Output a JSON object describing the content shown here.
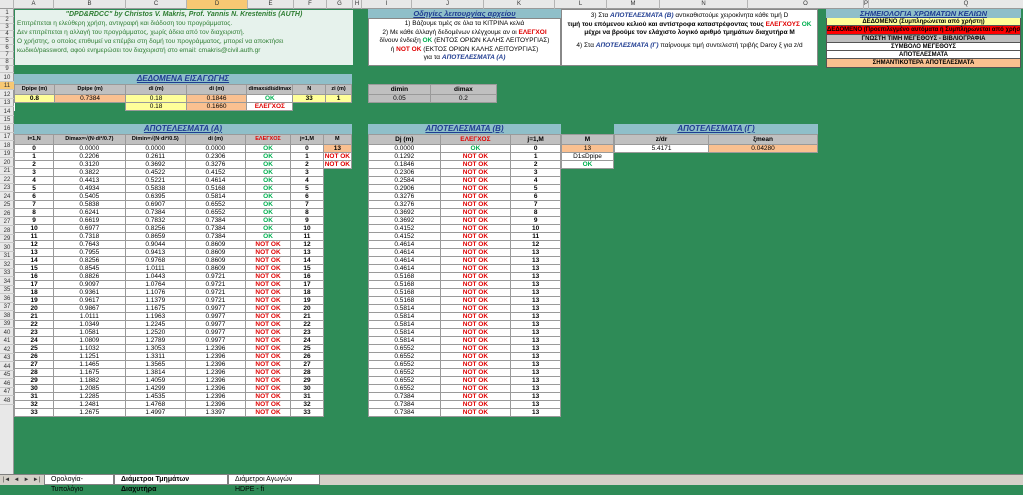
{
  "columns": [
    "A",
    "B",
    "C",
    "D",
    "E",
    "F",
    "G",
    "H",
    "I",
    "J",
    "K",
    "L",
    "M",
    "N",
    "O",
    "P",
    "Q"
  ],
  "header_box": {
    "title": "\"DPD&RDCC\" by Christos V. Makris, Prof. Yannis N. Krestenitis (AUTH)",
    "lines": [
      "Επιτρέπεται η ελεύθερη χρήση, αντιγραφή και διάδοση του προγράμματος.",
      "Δεν επιτρέπεται η αλλαγή του προγράμματος, χωρίς άδεια από τον διαχειριστή.",
      "Ο χρήστης, ο οποίος επιθυμεί να επέμβει στη δομή του προγράμματος, μπορεί να αποκτήσει",
      "κωδικό/password, αφού ενημερώσει τον διαχειριστή στο email: cmakris@civil.auth.gr"
    ]
  },
  "instructions": {
    "title": "Οδηγίες λειτουργίας αρχείου",
    "l1": "1) Βάζουμε τιμές σε όλα τα ΚΙΤΡΙΝΑ κελιά",
    "l2a": "2) Με κάθε άλλαγή δεδομένων ελέγχουμε αν οι",
    "l2b": "ΕΛΕΓΧΟΙ",
    "l2c": "δίνουν ένδειξη",
    "l2d": "OK",
    "l2e": "(ΕΝΤΟΣ ΟΡΙΩΝ ΚΑΛΗΣ ΛΕΙΤΟΥΡΓΙΑΣ)",
    "l2f": "ή",
    "l2g": "NOT OK",
    "l2h": "(ΕΚΤΟΣ ΟΡΙΩΝ ΚΑΛΗΣ ΛΕΙΤΟΥΡΓΙΑΣ)",
    "l2i": "για τα",
    "l2j": "ΑΠΟΤΕΛΕΣΜΑΤΑ (Α)",
    "l3a": "3) Στα",
    "l3b": "ΑΠΟΤΕΛΕΣΜΑΤΑ (Β)",
    "l3c": "αντικαθιστούμε χειροκίνητα κάθε τιμή D",
    "l3d": "τιμή του επόμενου κελιού και αντίστροφα καταστρέφοντας τους",
    "l3e": "ΕΛΕΓΧΟΥΣ",
    "l3f": "OK",
    "l3g": "μέχρι να βρούμε τον ελάχιστο λογικό αριθμό τμημάτων διαχυτήρα M",
    "l4a": "4) Στα",
    "l4b": "ΑΠΟΤΕΛΕΣΜΑΤΑ (Γ)",
    "l4c": "παίρνουμε τιμή συντελεστή τριβής Darcy ξ για z/d"
  },
  "legend": {
    "title": "ΣΗΜΕΙΟΛΟΓΙΑ ΧΡΩΜΑΤΩΝ ΚΕΛΙΩΝ",
    "items": [
      {
        "label": "ΔΕΔΟΜΕΝΟ (Συμπληρώνεται από χρήστη)",
        "color": "#ffff99",
        "text": "#000"
      },
      {
        "label": "ΔΕΔΟΜΕΝΟ (Προεπιλεγμένο αυτόματα ή Συμπληρώνεται από χρήστη)",
        "color": "#ff0000",
        "text": "#000"
      },
      {
        "label": "ΓΝΩΣΤΗ ΤΙΜΗ ΜΕΓΕΘΟΥΣ - ΒΙΒΛΙΟΓΡΑΦΙΑ",
        "color": "#bfbfbf",
        "text": "#000"
      },
      {
        "label": "ΣΥΜΒΟΛΟ ΜΕΓΕΘΟΥΣ",
        "color": "#ffffff",
        "text": "#000"
      },
      {
        "label": "ΑΠΟΤΕΛΕΣΜΑΤΑ",
        "color": "#ffffff",
        "text": "#000"
      },
      {
        "label": "ΣΗΜΑΝΤΙΚΟΤΕΡΑ ΑΠΟΤΕΛΕΣΜΑΤΑ",
        "color": "#fac090",
        "text": "#000"
      }
    ]
  },
  "input": {
    "title": "ΔΕΔΟΜΕΝΑ ΕΙΣΑΓΩΓΗΣ",
    "headers": [
      "Dpipe (m)",
      "Dpipe (m)",
      "di (m)",
      "di (m)",
      "dimax≤di≤dimax",
      "N",
      "zi (m)"
    ],
    "row10": [
      "0.8",
      "0.7384",
      "0.18",
      "0.1846",
      "OK",
      "33",
      "1"
    ],
    "row11": [
      "",
      "",
      "0.18",
      "0.1660",
      "ΕΛΕΓΧΟΣ",
      "",
      ""
    ],
    "right_headers": [
      "dimin",
      "dimax"
    ],
    "right_row": [
      "0.05",
      "0.2"
    ]
  },
  "resA": {
    "title": "ΑΠΟΤΕΛΕΣΜΑΤΑ (Α)",
    "headers": [
      "i=1,N",
      "Dimax=√(N·di²/0.7)",
      "Dimin=√(N·di²/0.5)",
      "di (m)",
      "ΕΛΕΓΧΟΣ",
      "j=1,M",
      "M"
    ],
    "M": "13",
    "m_extra": [
      "",
      "NOT OK",
      "NOT OK"
    ],
    "rows": [
      [
        "0",
        "0.0000",
        "0.0000",
        "0.0000",
        "OK",
        "0"
      ],
      [
        "1",
        "0.2206",
        "0.2611",
        "0.2306",
        "OK",
        "1"
      ],
      [
        "2",
        "0.3120",
        "0.3692",
        "0.3276",
        "OK",
        "2"
      ],
      [
        "3",
        "0.3822",
        "0.4522",
        "0.4152",
        "OK",
        "3"
      ],
      [
        "4",
        "0.4413",
        "0.5221",
        "0.4614",
        "OK",
        "4"
      ],
      [
        "5",
        "0.4934",
        "0.5838",
        "0.5168",
        "OK",
        "5"
      ],
      [
        "6",
        "0.5405",
        "0.6395",
        "0.5814",
        "OK",
        "6"
      ],
      [
        "7",
        "0.5838",
        "0.6907",
        "0.6552",
        "OK",
        "7"
      ],
      [
        "8",
        "0.6241",
        "0.7384",
        "0.6552",
        "OK",
        "8"
      ],
      [
        "9",
        "0.6619",
        "0.7832",
        "0.7384",
        "OK",
        "9"
      ],
      [
        "10",
        "0.6977",
        "0.8256",
        "0.7384",
        "OK",
        "10"
      ],
      [
        "11",
        "0.7318",
        "0.8659",
        "0.7384",
        "OK",
        "11"
      ],
      [
        "12",
        "0.7643",
        "0.9044",
        "0.8609",
        "NOT OK",
        "12"
      ],
      [
        "13",
        "0.7955",
        "0.9413",
        "0.8609",
        "NOT OK",
        "13"
      ],
      [
        "14",
        "0.8256",
        "0.9768",
        "0.8609",
        "NOT OK",
        "14"
      ],
      [
        "15",
        "0.8545",
        "1.0111",
        "0.8609",
        "NOT OK",
        "15"
      ],
      [
        "16",
        "0.8826",
        "1.0443",
        "0.9721",
        "NOT OK",
        "16"
      ],
      [
        "17",
        "0.9097",
        "1.0764",
        "0.9721",
        "NOT OK",
        "17"
      ],
      [
        "18",
        "0.9361",
        "1.1076",
        "0.9721",
        "NOT OK",
        "18"
      ],
      [
        "19",
        "0.9617",
        "1.1379",
        "0.9721",
        "NOT OK",
        "19"
      ],
      [
        "20",
        "0.9867",
        "1.1675",
        "0.9977",
        "NOT OK",
        "20"
      ],
      [
        "21",
        "1.0111",
        "1.1963",
        "0.9977",
        "NOT OK",
        "21"
      ],
      [
        "22",
        "1.0349",
        "1.2245",
        "0.9977",
        "NOT OK",
        "22"
      ],
      [
        "23",
        "1.0581",
        "1.2520",
        "0.9977",
        "NOT OK",
        "23"
      ],
      [
        "24",
        "1.0809",
        "1.2789",
        "0.9977",
        "NOT OK",
        "24"
      ],
      [
        "25",
        "1.1032",
        "1.3053",
        "1.2396",
        "NOT OK",
        "25"
      ],
      [
        "26",
        "1.1251",
        "1.3311",
        "1.2396",
        "NOT OK",
        "26"
      ],
      [
        "27",
        "1.1465",
        "1.3565",
        "1.2396",
        "NOT OK",
        "27"
      ],
      [
        "28",
        "1.1675",
        "1.3814",
        "1.2396",
        "NOT OK",
        "28"
      ],
      [
        "29",
        "1.1882",
        "1.4059",
        "1.2396",
        "NOT OK",
        "29"
      ],
      [
        "30",
        "1.2085",
        "1.4299",
        "1.2396",
        "NOT OK",
        "30"
      ],
      [
        "31",
        "1.2285",
        "1.4535",
        "1.2396",
        "NOT OK",
        "31"
      ],
      [
        "32",
        "1.2481",
        "1.4768",
        "1.2396",
        "NOT OK",
        "32"
      ],
      [
        "33",
        "1.2675",
        "1.4997",
        "1.3397",
        "NOT OK",
        "33"
      ]
    ]
  },
  "resB": {
    "title": "ΑΠΟΤΕΛΕΣΜΑΤΑ (Β)",
    "headers": [
      "Dj (m)",
      "ΕΛΕΓΧΟΣ",
      "j=1,M"
    ],
    "rows": [
      [
        "0.0000",
        "OK",
        "0"
      ],
      [
        "0.1292",
        "NOT OK",
        "1"
      ],
      [
        "0.1846",
        "NOT OK",
        "2"
      ],
      [
        "0.2306",
        "NOT OK",
        "3"
      ],
      [
        "0.2584",
        "NOT OK",
        "4"
      ],
      [
        "0.2906",
        "NOT OK",
        "5"
      ],
      [
        "0.3276",
        "NOT OK",
        "6"
      ],
      [
        "0.3276",
        "NOT OK",
        "7"
      ],
      [
        "0.3692",
        "NOT OK",
        "8"
      ],
      [
        "0.3692",
        "NOT OK",
        "9"
      ],
      [
        "0.4152",
        "NOT OK",
        "10"
      ],
      [
        "0.4152",
        "NOT OK",
        "11"
      ],
      [
        "0.4614",
        "NOT OK",
        "12"
      ],
      [
        "0.4614",
        "NOT OK",
        "13"
      ],
      [
        "0.4614",
        "NOT OK",
        "13"
      ],
      [
        "0.4614",
        "NOT OK",
        "13"
      ],
      [
        "0.5168",
        "NOT OK",
        "13"
      ],
      [
        "0.5168",
        "NOT OK",
        "13"
      ],
      [
        "0.5168",
        "NOT OK",
        "13"
      ],
      [
        "0.5168",
        "NOT OK",
        "13"
      ],
      [
        "0.5814",
        "NOT OK",
        "13"
      ],
      [
        "0.5814",
        "NOT OK",
        "13"
      ],
      [
        "0.5814",
        "NOT OK",
        "13"
      ],
      [
        "0.5814",
        "NOT OK",
        "13"
      ],
      [
        "0.5814",
        "NOT OK",
        "13"
      ],
      [
        "0.6552",
        "NOT OK",
        "13"
      ],
      [
        "0.6552",
        "NOT OK",
        "13"
      ],
      [
        "0.6552",
        "NOT OK",
        "13"
      ],
      [
        "0.6552",
        "NOT OK",
        "13"
      ],
      [
        "0.6552",
        "NOT OK",
        "13"
      ],
      [
        "0.6552",
        "NOT OK",
        "13"
      ],
      [
        "0.7384",
        "NOT OK",
        "13"
      ],
      [
        "0.7384",
        "NOT OK",
        "13"
      ],
      [
        "0.7384",
        "NOT OK",
        "13"
      ]
    ],
    "M_label": "M",
    "M": "13",
    "ratio_label": "D1≤Dpipe",
    "ratio_status": "OK"
  },
  "resC": {
    "title": "ΑΠΟΤΕΛΕΣΜΑΤΑ (Γ)",
    "headers": [
      "z/dr",
      "ξmean"
    ],
    "row": [
      "5.4171",
      "0.04280"
    ]
  },
  "tabs": [
    "Ορολογία-Τυπολόγιο",
    "Διάμετροι Τμημάτων Διαχυτήρα",
    "Διάμετροι Αγωγών HDPE - fi"
  ]
}
